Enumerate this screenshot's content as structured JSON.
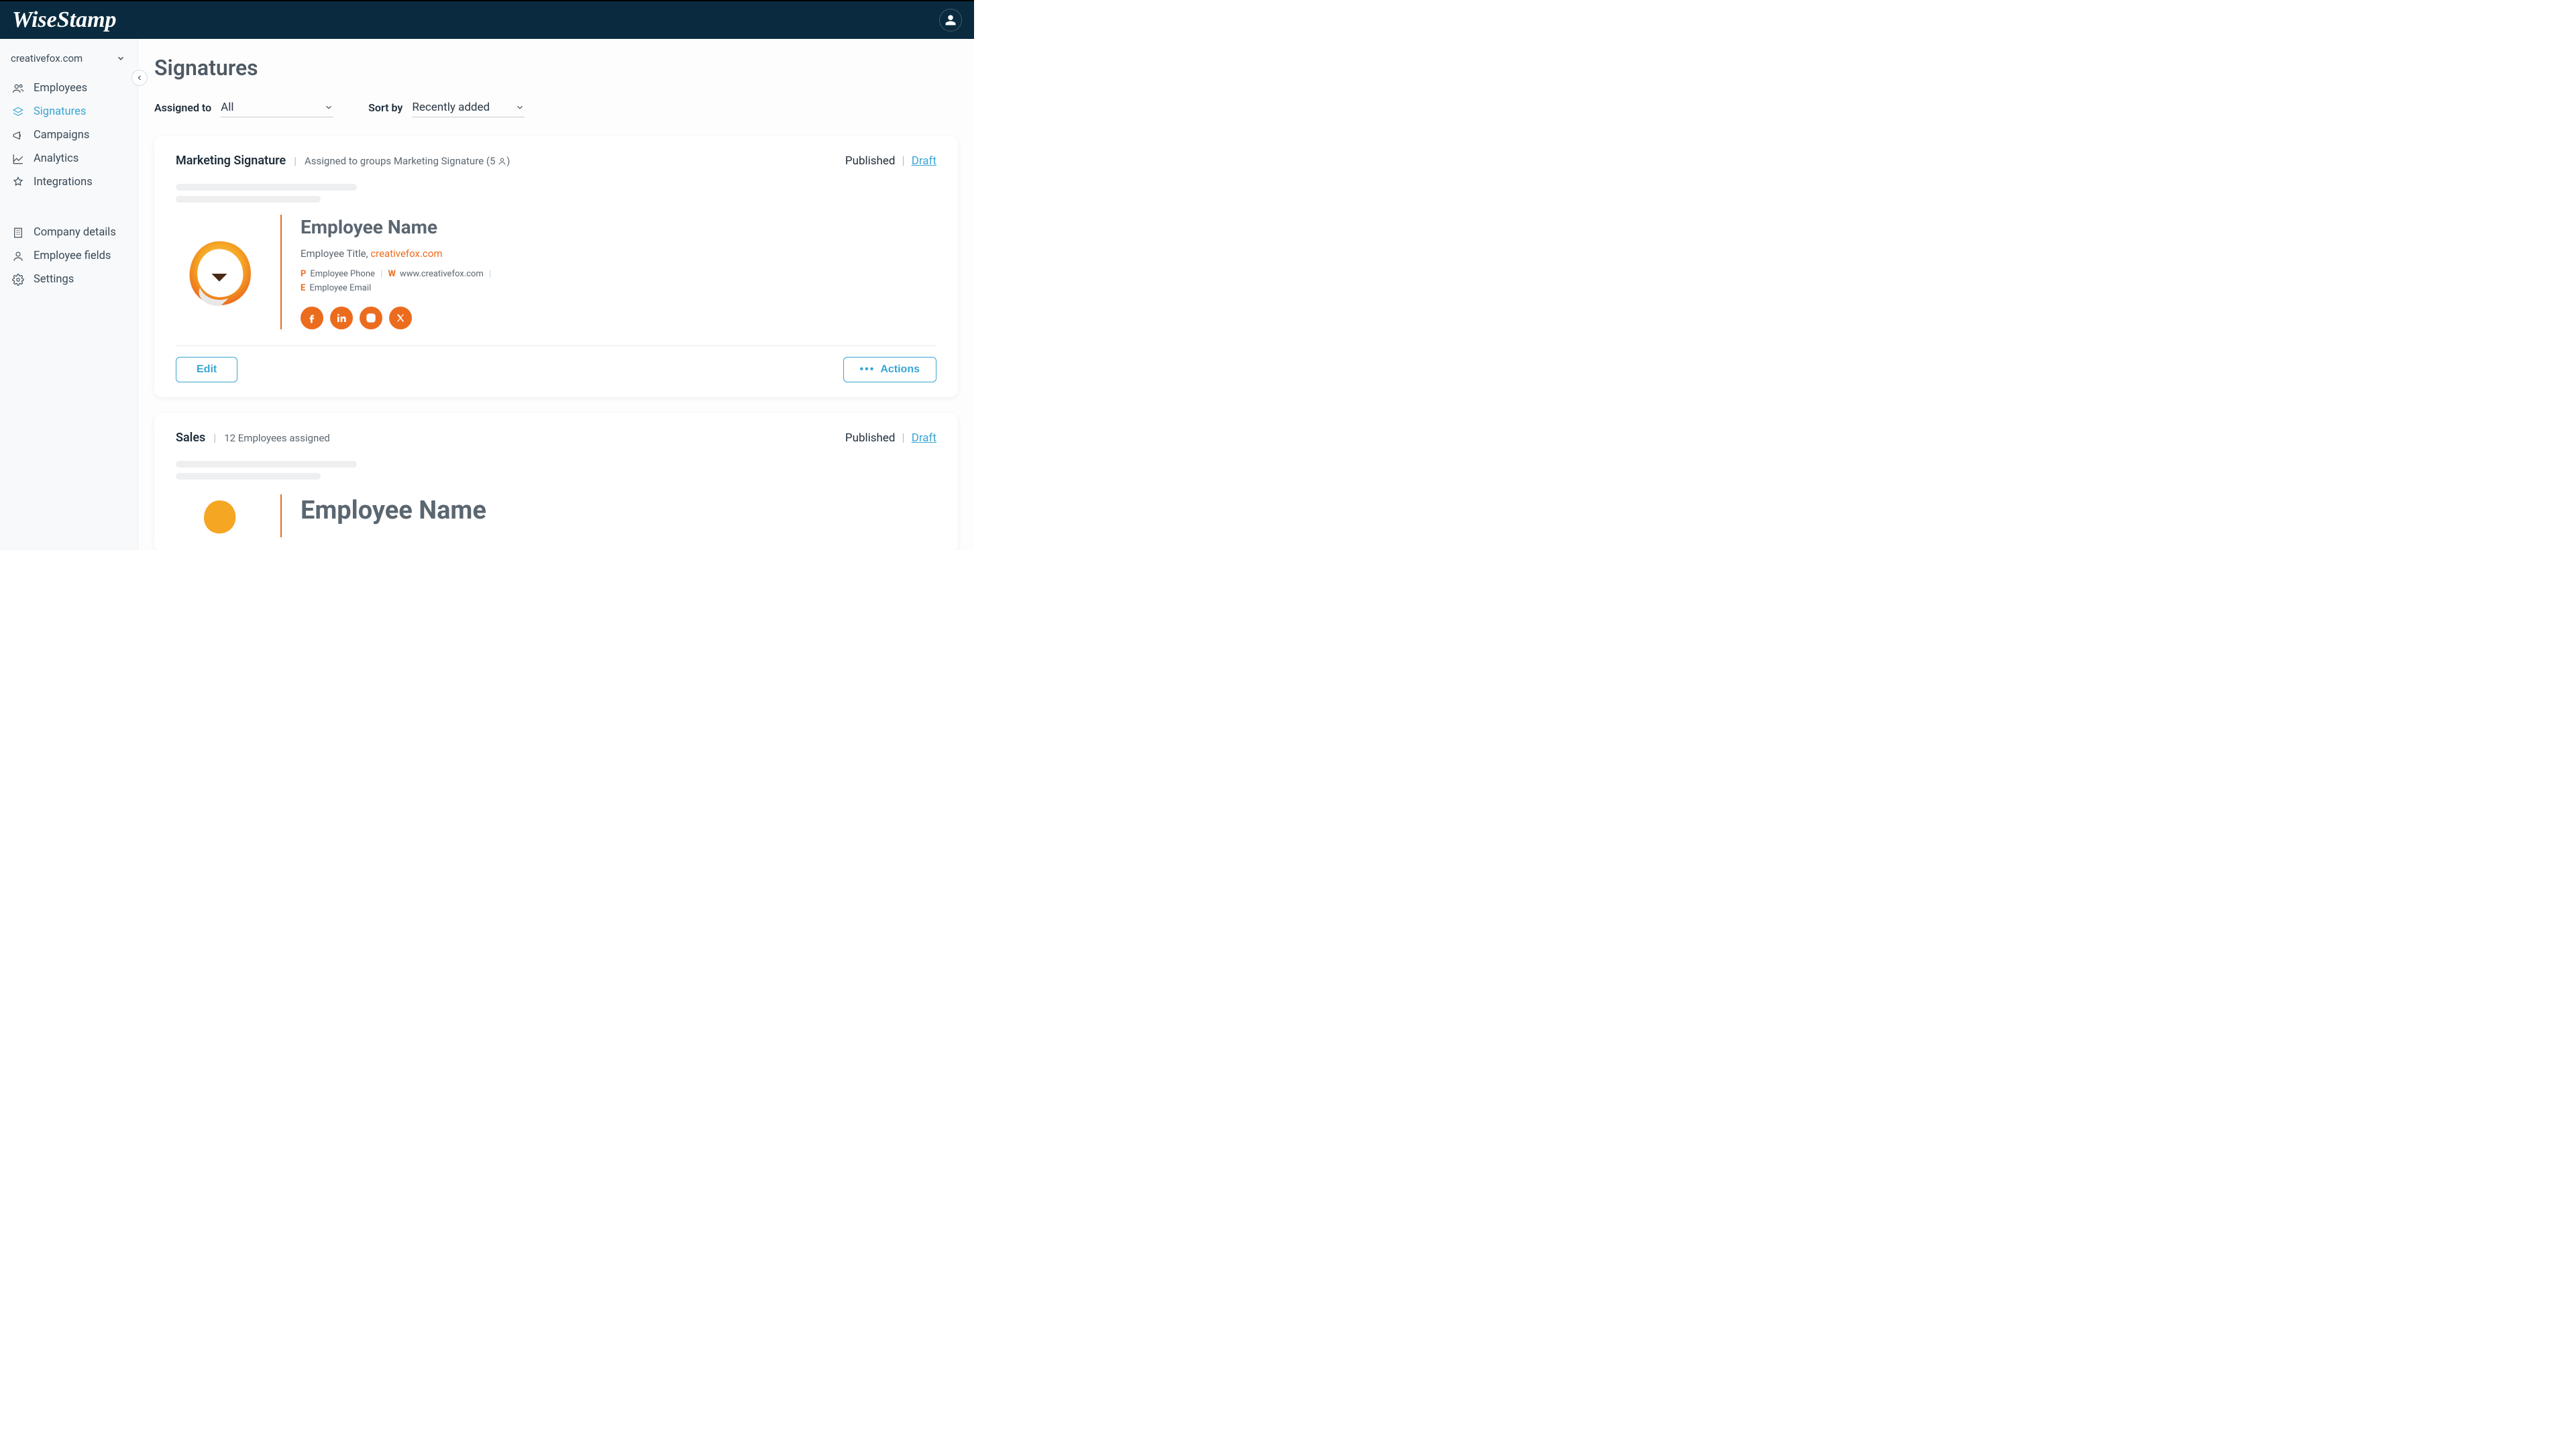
{
  "brand": "WiseStamp",
  "org": "creativefox.com",
  "page_title": "Signatures",
  "sidebar": {
    "items": [
      {
        "label": "Employees"
      },
      {
        "label": "Signatures"
      },
      {
        "label": "Campaigns"
      },
      {
        "label": "Analytics"
      },
      {
        "label": "Integrations"
      },
      {
        "label": "Company details"
      },
      {
        "label": "Employee fields"
      },
      {
        "label": "Settings"
      }
    ]
  },
  "filters": {
    "assigned_label": "Assigned to",
    "assigned_value": "All",
    "sort_label": "Sort by",
    "sort_value": "Recently added"
  },
  "cards": [
    {
      "name": "Marketing Signature",
      "meta": "Assigned to groups Marketing Signature (5 ",
      "meta_tail": ")",
      "head_count": "5",
      "published": "Published",
      "draft": "Draft",
      "employee_name": "Employee Name",
      "employee_title": "Employee Title, ",
      "domain": "creativefox.com",
      "phone_label": "P",
      "phone": "Employee Phone",
      "web_label": "W",
      "web": "www.creativefox.com",
      "email_label": "E",
      "email": "Employee Email",
      "edit": "Edit",
      "actions": "Actions"
    },
    {
      "name": "Sales",
      "meta": "12 Employees assigned",
      "published": "Published",
      "draft": "Draft",
      "employee_name": "Employee Name"
    }
  ]
}
